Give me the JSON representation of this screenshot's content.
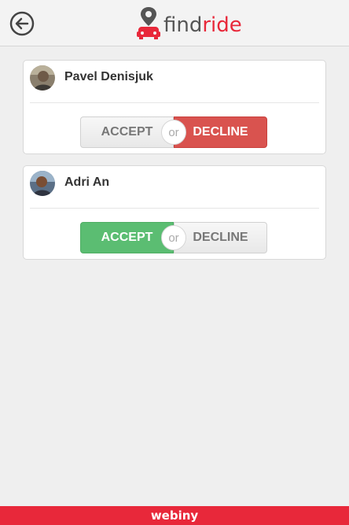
{
  "header": {
    "back_icon": "back-arrow-icon",
    "logo_find": "find",
    "logo_ride": "ride",
    "logo_icon": "car-pin-icon"
  },
  "requests": [
    {
      "name": "Pavel Denisjuk",
      "accept_label": "ACCEPT",
      "or_label": "or",
      "decline_label": "DECLINE",
      "state": "declined"
    },
    {
      "name": "Adri An",
      "accept_label": "ACCEPT",
      "or_label": "or",
      "decline_label": "DECLINE",
      "state": "accepted"
    }
  ],
  "footer": {
    "brand": "webiny"
  },
  "colors": {
    "brand": "#e8283a",
    "accept": "#5bbd72",
    "decline": "#d9534f"
  }
}
